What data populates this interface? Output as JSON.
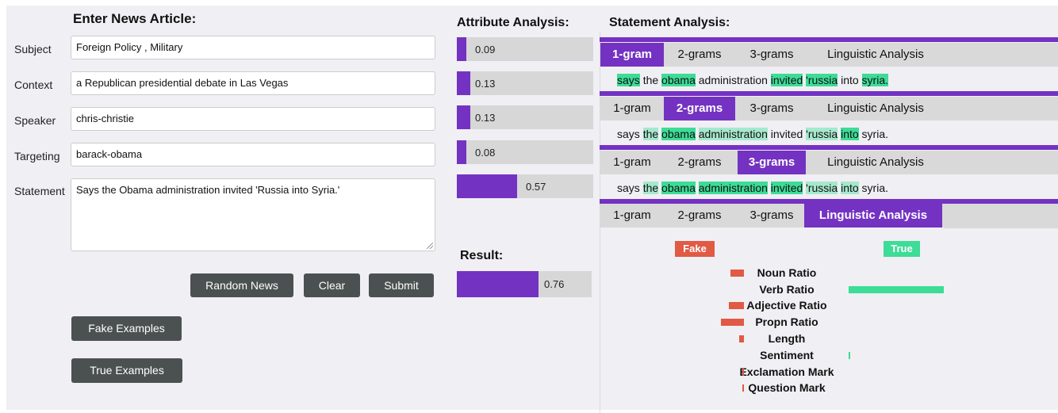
{
  "form": {
    "heading": "Enter News Article:",
    "subject_label": "Subject",
    "subject_value": "Foreign Policy , Military",
    "context_label": "Context",
    "context_value": "a Republican presidential debate in Las Vegas",
    "speaker_label": "Speaker",
    "speaker_value": "chris-christie",
    "targeting_label": "Targeting",
    "targeting_value": "barack-obama",
    "statement_label": "Statement",
    "statement_value": "Says the Obama administration invited 'Russia into Syria.'",
    "random_label": "Random News",
    "clear_label": "Clear",
    "submit_label": "Submit",
    "fake_examples_label": "Fake Examples",
    "true_examples_label": "True Examples"
  },
  "attribute": {
    "heading": "Attribute Analysis:",
    "items": [
      {
        "value": "0.09",
        "level": 0.09
      },
      {
        "value": "0.13",
        "level": 0.13
      },
      {
        "value": "0.13",
        "level": 0.13
      },
      {
        "value": "0.08",
        "level": 0.08
      },
      {
        "value": "0.57",
        "level": 0.57
      }
    ],
    "colors": {
      "fill": "#7432c2",
      "track": "#d7d7d7"
    }
  },
  "result": {
    "heading": "Result:",
    "value": "0.76",
    "level": 0.76
  },
  "statement": {
    "heading": "Statement Analysis:",
    "tabs": [
      "1-gram",
      "2-grams",
      "3-grams",
      "Linguistic Analysis"
    ],
    "sentence_words": [
      "says",
      "the",
      "obama",
      "administration",
      "invited",
      "'russia",
      "into",
      "syria."
    ]
  },
  "linguistic": {
    "fake_label": "Fake",
    "true_label": "True",
    "colors": {
      "fake": "#e05a44",
      "true": "#3ddc97"
    },
    "features": [
      {
        "label": "Noun Ratio",
        "fake": 0.14,
        "true": 0
      },
      {
        "label": "Verb Ratio",
        "fake": 0,
        "true": 1.0
      },
      {
        "label": "Adjective Ratio",
        "fake": 0.16,
        "true": 0
      },
      {
        "label": "Propn Ratio",
        "fake": 0.24,
        "true": 0
      },
      {
        "label": "Length",
        "fake": 0.05,
        "true": 0
      },
      {
        "label": "Sentiment",
        "fake": 0,
        "true": 0.02
      },
      {
        "label": "Exclamation Mark",
        "fake": 0.01,
        "true": 0
      },
      {
        "label": "Question Mark",
        "fake": 0.01,
        "true": 0
      }
    ]
  }
}
